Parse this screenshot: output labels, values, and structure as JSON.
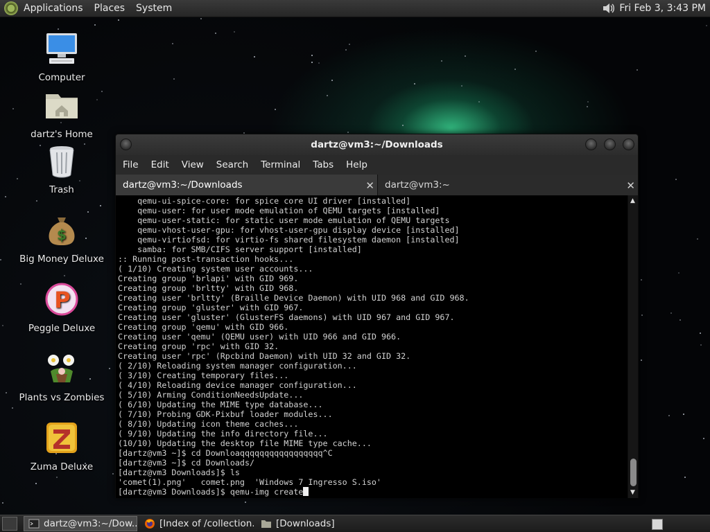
{
  "top_panel": {
    "menus": [
      "Applications",
      "Places",
      "System"
    ],
    "clock": "Fri Feb  3,  3:43 PM"
  },
  "desktop_icons": [
    {
      "label": "Computer",
      "icon": "computer-icon"
    },
    {
      "label": "dartz's Home",
      "icon": "home-folder-icon"
    },
    {
      "label": "Trash",
      "icon": "trash-icon"
    },
    {
      "label": "Big Money Deluxe",
      "icon": "money-bag-icon"
    },
    {
      "label": "Peggle Deluxe",
      "icon": "peggle-icon"
    },
    {
      "label": "Plants vs Zombies",
      "icon": "plants-vs-zombies-icon"
    },
    {
      "label": "Zuma Deluxe",
      "icon": "zuma-icon"
    }
  ],
  "terminal": {
    "title": "dartz@vm3:~/Downloads",
    "menu": [
      "File",
      "Edit",
      "View",
      "Search",
      "Terminal",
      "Tabs",
      "Help"
    ],
    "tabs": [
      {
        "label": "dartz@vm3:~/Downloads",
        "active": true
      },
      {
        "label": "dartz@vm3:~",
        "active": false
      }
    ],
    "output": "    qemu-ui-spice-core: for spice core UI driver [installed]\n    qemu-user: for user mode emulation of QEMU targets [installed]\n    qemu-user-static: for static user mode emulation of QEMU targets\n    qemu-vhost-user-gpu: for vhost-user-gpu display device [installed]\n    qemu-virtiofsd: for virtio-fs shared filesystem daemon [installed]\n    samba: for SMB/CIFS server support [installed]\n:: Running post-transaction hooks...\n( 1/10) Creating system user accounts...\nCreating group 'brlapi' with GID 969.\nCreating group 'brltty' with GID 968.\nCreating user 'brltty' (Braille Device Daemon) with UID 968 and GID 968.\nCreating group 'gluster' with GID 967.\nCreating user 'gluster' (GlusterFS daemons) with UID 967 and GID 967.\nCreating group 'qemu' with GID 966.\nCreating user 'qemu' (QEMU user) with UID 966 and GID 966.\nCreating group 'rpc' with GID 32.\nCreating user 'rpc' (Rpcbind Daemon) with UID 32 and GID 32.\n( 2/10) Reloading system manager configuration...\n( 3/10) Creating temporary files...\n( 4/10) Reloading device manager configuration...\n( 5/10) Arming ConditionNeedsUpdate...\n( 6/10) Updating the MIME type database...\n( 7/10) Probing GDK-Pixbuf loader modules...\n( 8/10) Updating icon theme caches...\n( 9/10) Updating the info directory file...\n(10/10) Updating the desktop file MIME type cache...\n[dartz@vm3 ~]$ cd Downloaqqqqqqqqqqqqqqqqq^C\n[dartz@vm3 ~]$ cd Downloads/\n[dartz@vm3 Downloads]$ ls\n'comet(1).png'   comet.png  'Windows 7 Ingresso S.iso'",
    "prompt_line": "[dartz@vm3 Downloads]$ qemu-img create"
  },
  "taskbar": {
    "tasks": [
      {
        "label": "dartz@vm3:~/Dow...",
        "icon": "terminal-icon",
        "active": true
      },
      {
        "label": "[Index of /collection...",
        "icon": "firefox-icon",
        "active": false
      },
      {
        "label": "[Downloads]",
        "icon": "folder-icon",
        "active": false
      }
    ]
  }
}
